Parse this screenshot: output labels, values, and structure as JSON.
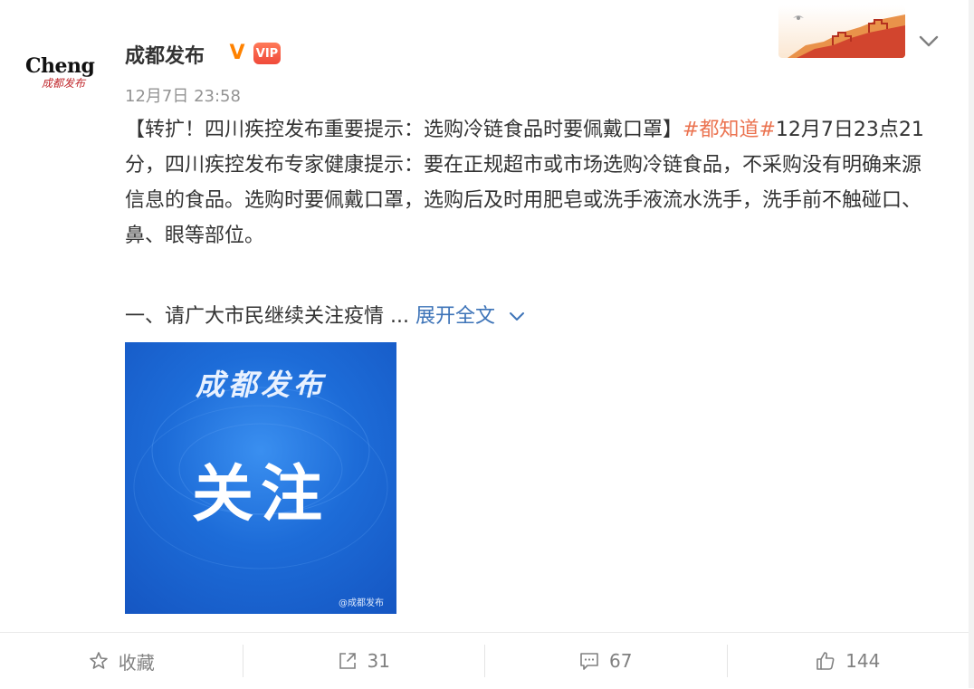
{
  "header": {
    "avatar_text_main": "Cheng",
    "avatar_text_sub": "成都发布",
    "user_name": "成都发布",
    "verified_mark": "V",
    "member_mark": "VIP",
    "post_time": "12月7日 23:58",
    "banner": "great-wall-banner",
    "menu_icon": "chevron-down-icon"
  },
  "post": {
    "text_prefix": "【转扩！四川疾控发布重要提示：选购冷链食品时要佩戴口罩】",
    "topic": "#都知道#",
    "text_rest": "12月7日23点21分，四川疾控发布专家健康提示：要在正规超市或市场选购冷链食品，不采购没有明确来源信息的食品。选购时要佩戴口罩，选购后及时用肥皂或洗手液流水洗手，洗手前不触碰口、鼻、眼等部位。",
    "teaser": "一、请广大市民继续关注疫情 ...",
    "expand_label": "展开全文",
    "colors": {
      "topic": "#eb7350",
      "link": "#3e74b8"
    }
  },
  "image": {
    "script_text": "成都发布",
    "main_text": "关注",
    "watermark": "@成都发布",
    "colors": {
      "background": "#1d6cd8"
    }
  },
  "toolbar": {
    "favorite_label": "收藏",
    "repost_count": "31",
    "comment_count": "67",
    "like_count": "144"
  }
}
